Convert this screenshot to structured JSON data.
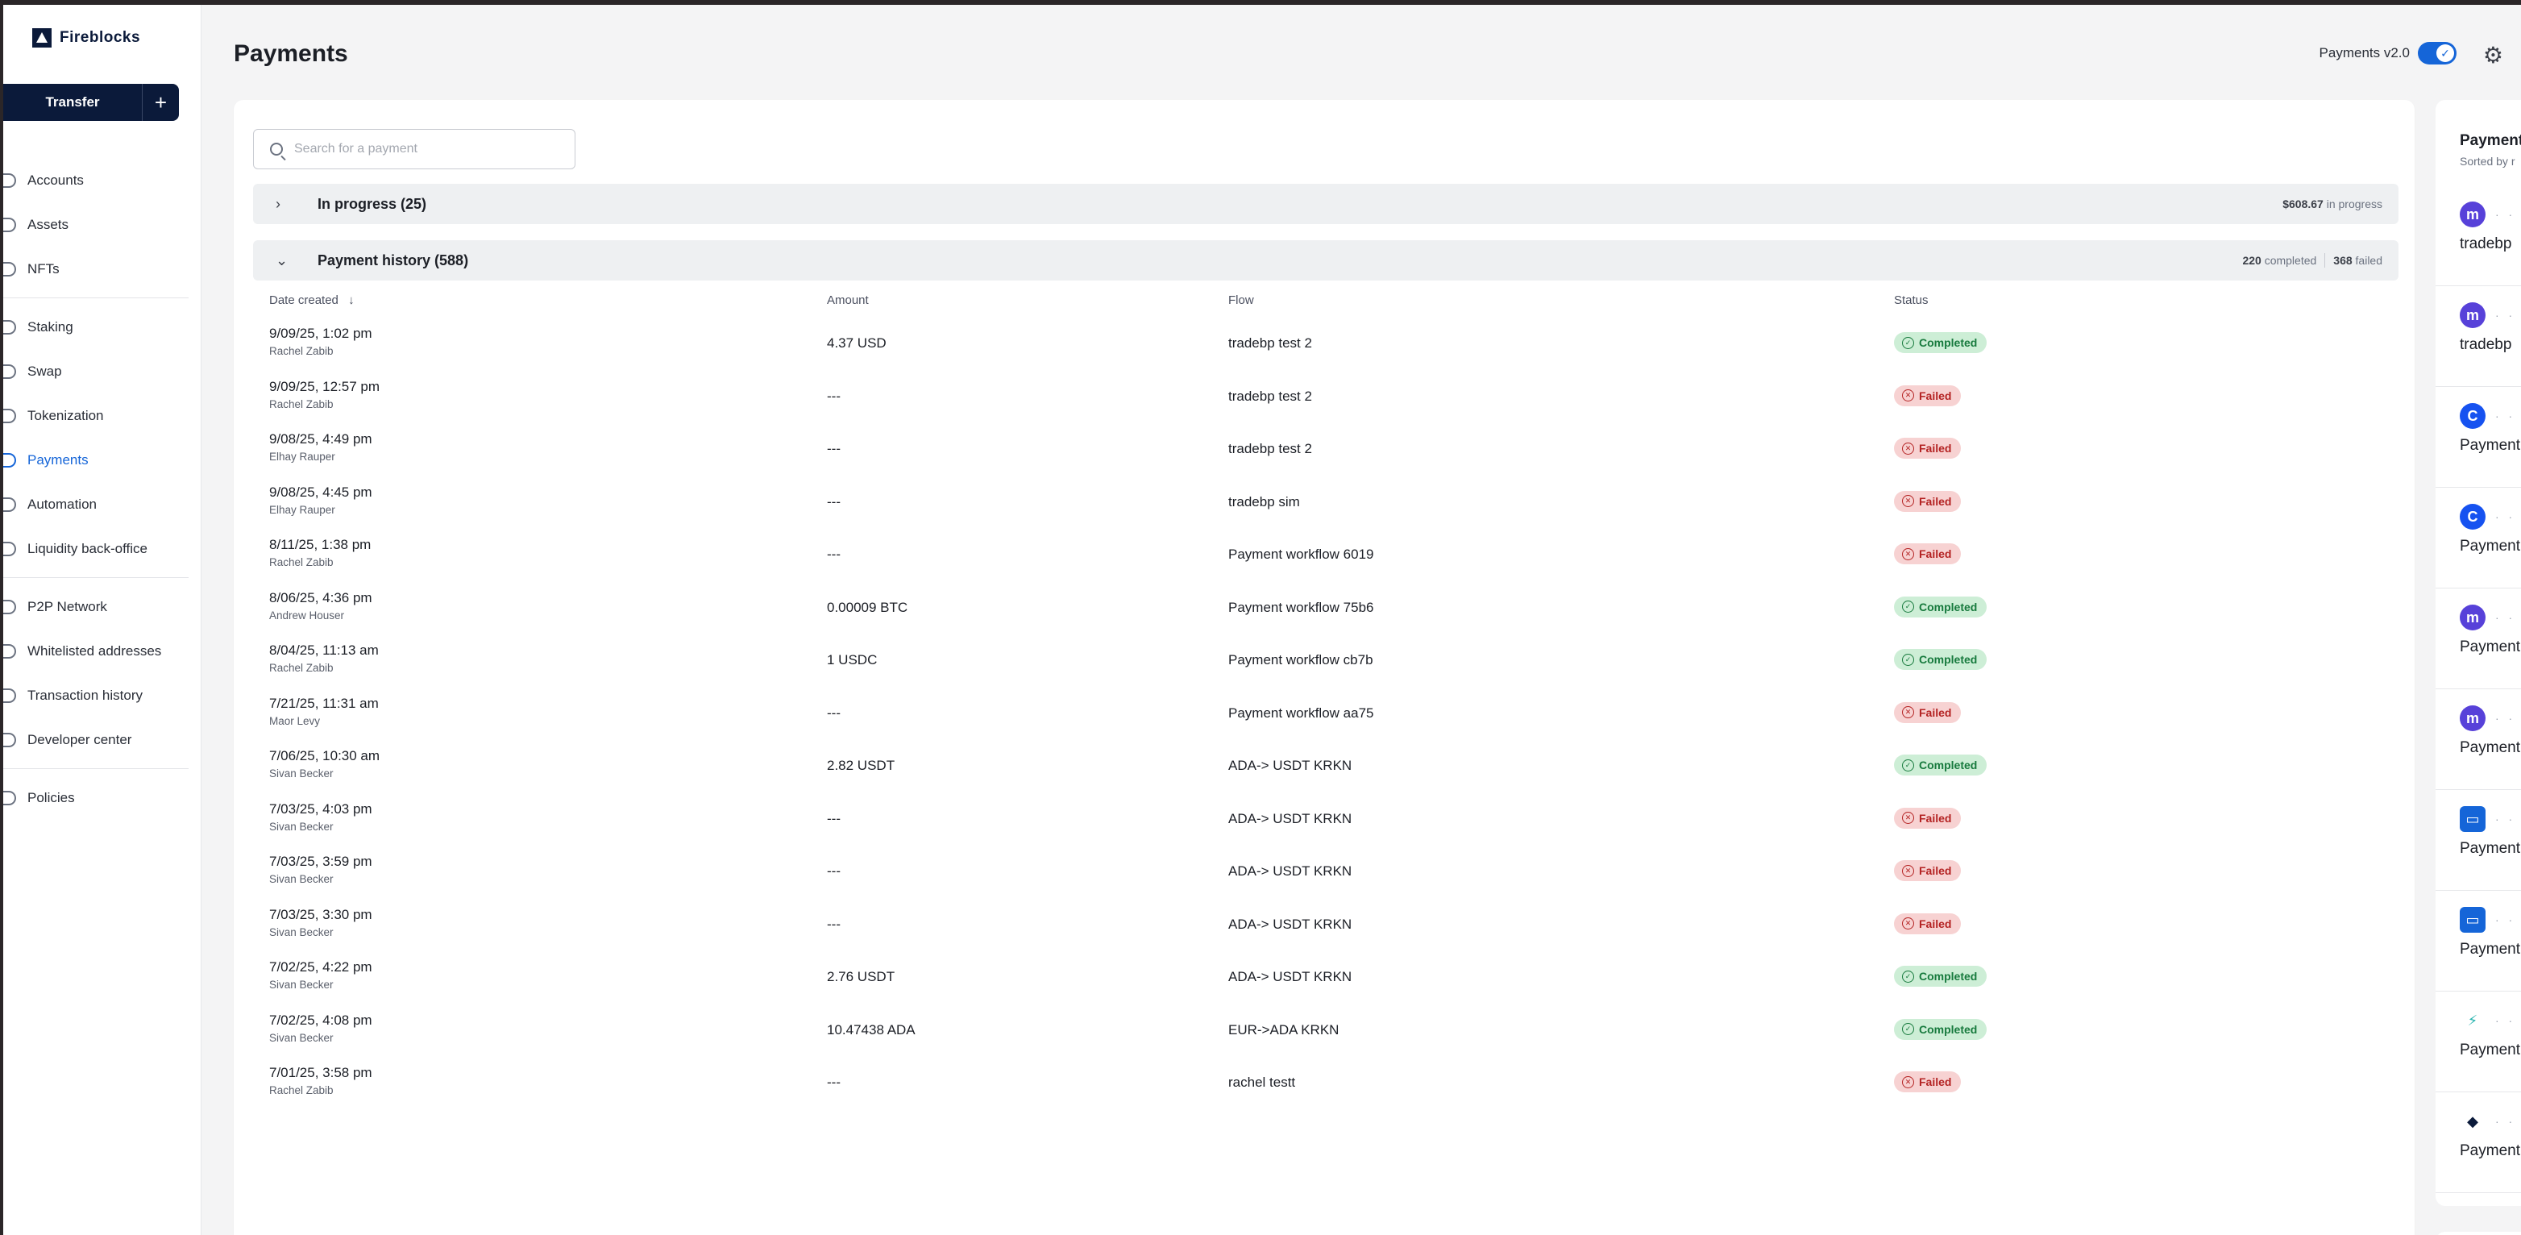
{
  "brand": {
    "name": "Fireblocks"
  },
  "sidebar": {
    "transfer_label": "Transfer",
    "plus_label": "+",
    "groups": [
      [
        {
          "label": "Accounts",
          "active": false
        },
        {
          "label": "Assets",
          "active": false
        },
        {
          "label": "NFTs",
          "active": false
        }
      ],
      [
        {
          "label": "Staking",
          "active": false
        },
        {
          "label": "Swap",
          "active": false
        },
        {
          "label": "Tokenization",
          "active": false
        },
        {
          "label": "Payments",
          "active": true
        },
        {
          "label": "Automation",
          "active": false
        },
        {
          "label": "Liquidity back-office",
          "active": false
        }
      ],
      [
        {
          "label": "P2P Network",
          "active": false
        },
        {
          "label": "Whitelisted addresses",
          "active": false
        },
        {
          "label": "Transaction history",
          "active": false
        },
        {
          "label": "Developer center",
          "active": false
        }
      ],
      [
        {
          "label": "Policies",
          "active": false
        }
      ]
    ]
  },
  "header": {
    "title": "Payments",
    "version_label": "Payments v2.0",
    "version_enabled": true
  },
  "search": {
    "placeholder": "Search for a payment"
  },
  "in_progress": {
    "title": "In progress (25)",
    "amount": "$608.67",
    "suffix": "in progress"
  },
  "history": {
    "title": "Payment history (588)",
    "completed_count": "220",
    "completed_label": "completed",
    "failed_count": "368",
    "failed_label": "failed"
  },
  "table": {
    "columns": {
      "date": "Date created",
      "sort_indicator": "↓",
      "amount": "Amount",
      "flow": "Flow",
      "status": "Status"
    },
    "rows": [
      {
        "date": "9/09/25, 1:02 pm",
        "user": "Rachel Zabib",
        "amount": "4.37 USD",
        "flow": "tradebp test 2",
        "status": "Completed"
      },
      {
        "date": "9/09/25, 12:57 pm",
        "user": "Rachel Zabib",
        "amount": "---",
        "flow": "tradebp test 2",
        "status": "Failed"
      },
      {
        "date": "9/08/25, 4:49 pm",
        "user": "Elhay Rauper",
        "amount": "---",
        "flow": "tradebp test 2",
        "status": "Failed"
      },
      {
        "date": "9/08/25, 4:45 pm",
        "user": "Elhay Rauper",
        "amount": "---",
        "flow": "tradebp sim",
        "status": "Failed"
      },
      {
        "date": "8/11/25, 1:38 pm",
        "user": "Rachel Zabib",
        "amount": "---",
        "flow": "Payment workflow 6019",
        "status": "Failed"
      },
      {
        "date": "8/06/25, 4:36 pm",
        "user": "Andrew Houser",
        "amount": "0.00009 BTC",
        "flow": "Payment workflow 75b6",
        "status": "Completed"
      },
      {
        "date": "8/04/25, 11:13 am",
        "user": "Rachel Zabib",
        "amount": "1 USDC",
        "flow": "Payment workflow cb7b",
        "status": "Completed"
      },
      {
        "date": "7/21/25, 11:31 am",
        "user": "Maor Levy",
        "amount": "---",
        "flow": "Payment workflow aa75",
        "status": "Failed"
      },
      {
        "date": "7/06/25, 10:30 am",
        "user": "Sivan Becker",
        "amount": "2.82 USDT",
        "flow": "ADA-> USDT KRKN",
        "status": "Completed"
      },
      {
        "date": "7/03/25, 4:03 pm",
        "user": "Sivan Becker",
        "amount": "---",
        "flow": "ADA-> USDT KRKN",
        "status": "Failed"
      },
      {
        "date": "7/03/25, 3:59 pm",
        "user": "Sivan Becker",
        "amount": "---",
        "flow": "ADA-> USDT KRKN",
        "status": "Failed"
      },
      {
        "date": "7/03/25, 3:30 pm",
        "user": "Sivan Becker",
        "amount": "---",
        "flow": "ADA-> USDT KRKN",
        "status": "Failed"
      },
      {
        "date": "7/02/25, 4:22 pm",
        "user": "Sivan Becker",
        "amount": "2.76 USDT",
        "flow": "ADA-> USDT KRKN",
        "status": "Completed"
      },
      {
        "date": "7/02/25, 4:08 pm",
        "user": "Sivan Becker",
        "amount": "10.47438 ADA",
        "flow": "EUR->ADA KRKN",
        "status": "Completed"
      },
      {
        "date": "7/01/25, 3:58 pm",
        "user": "Rachel Zabib",
        "amount": "---",
        "flow": "rachel testt",
        "status": "Failed"
      }
    ]
  },
  "right_panel": {
    "title": "Payment",
    "subtitle": "Sorted by r",
    "items": [
      {
        "icon": "kraken-icon",
        "color": "#5741d9",
        "label": "tradebp"
      },
      {
        "icon": "kraken-icon",
        "color": "#5741d9",
        "label": "tradebp"
      },
      {
        "icon": "coinbase-icon",
        "color": "#1652f0",
        "label": "Payment"
      },
      {
        "icon": "coinbase-icon",
        "color": "#1652f0",
        "label": "Payment"
      },
      {
        "icon": "kraken-icon",
        "color": "#5741d9",
        "label": "Payment"
      },
      {
        "icon": "kraken-icon",
        "color": "#5741d9",
        "label": "Payment"
      },
      {
        "icon": "bank-card-icon",
        "color": "#1565d8",
        "label": "Payment"
      },
      {
        "icon": "bank-card-icon",
        "color": "#1565d8",
        "label": "Payment"
      },
      {
        "icon": "lightning-icon",
        "color": "#2bb5b0",
        "label": "Payment"
      },
      {
        "icon": "diamond-logo-icon",
        "color": "#0b1a3a",
        "label": "Payment"
      }
    ]
  },
  "colors": {
    "brand_navy": "#0b1a3a",
    "accent_blue": "#1565d8",
    "completed_bg": "#cdeed6",
    "completed_fg": "#177a3d",
    "failed_bg": "#f7d2d2",
    "failed_fg": "#b42323"
  }
}
